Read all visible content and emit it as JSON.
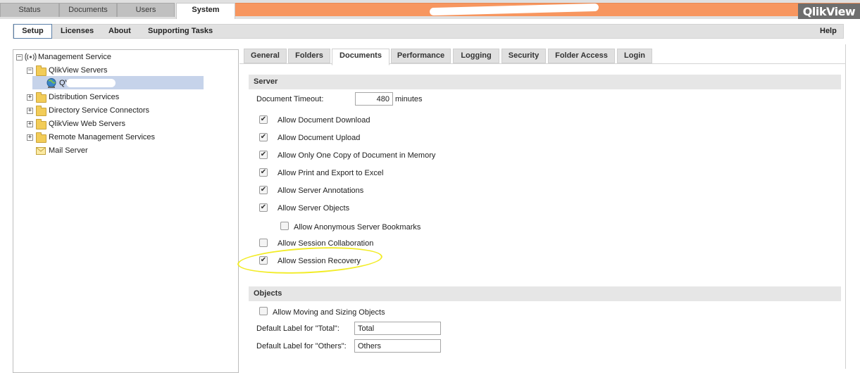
{
  "top_tabs": [
    {
      "label": "Status"
    },
    {
      "label": "Documents"
    },
    {
      "label": "Users"
    },
    {
      "label": "System"
    }
  ],
  "brand": {
    "logo_text": "QlikView"
  },
  "sub_nav": {
    "items": [
      {
        "label": "Setup"
      },
      {
        "label": "Licenses"
      },
      {
        "label": "About"
      },
      {
        "label": "Supporting Tasks"
      }
    ],
    "help": "Help"
  },
  "tree": {
    "root": "Management Service",
    "servers_folder": "QlikView Servers",
    "server_node": "QVS@",
    "nodes": [
      "Distribution Services",
      "Directory Service Connectors",
      "QlikView Web Servers",
      "Remote Management Services",
      "Mail Server"
    ]
  },
  "content_tabs": [
    {
      "label": "General"
    },
    {
      "label": "Folders"
    },
    {
      "label": "Documents"
    },
    {
      "label": "Performance"
    },
    {
      "label": "Logging"
    },
    {
      "label": "Security"
    },
    {
      "label": "Folder Access"
    },
    {
      "label": "Login"
    }
  ],
  "server_section": {
    "title": "Server",
    "timeout_label": "Document Timeout:",
    "timeout_value": "480",
    "timeout_unit": "minutes",
    "options": [
      {
        "label": "Allow Document Download",
        "checked": true
      },
      {
        "label": "Allow Document Upload",
        "checked": true
      },
      {
        "label": "Allow Only One Copy of Document in Memory",
        "checked": true
      },
      {
        "label": "Allow Print and Export to Excel",
        "checked": true
      },
      {
        "label": "Allow Server Annotations",
        "checked": true
      },
      {
        "label": "Allow Server Objects",
        "checked": true
      },
      {
        "label": "Allow Anonymous Server Bookmarks",
        "checked": false
      },
      {
        "label": "Allow Session Collaboration",
        "checked": false
      },
      {
        "label": "Allow Session Recovery",
        "checked": true
      }
    ]
  },
  "objects_section": {
    "title": "Objects",
    "moving_label": "Allow Moving and Sizing Objects",
    "moving_checked": false,
    "total_label": "Default Label for \"Total\":",
    "total_value": "Total",
    "others_label": "Default Label for \"Others\":",
    "others_value": "Others"
  },
  "colors": {
    "brand_orange": "#f7965f",
    "selection": "#c6d3ea",
    "highlight_marker": "#f2ec26"
  }
}
